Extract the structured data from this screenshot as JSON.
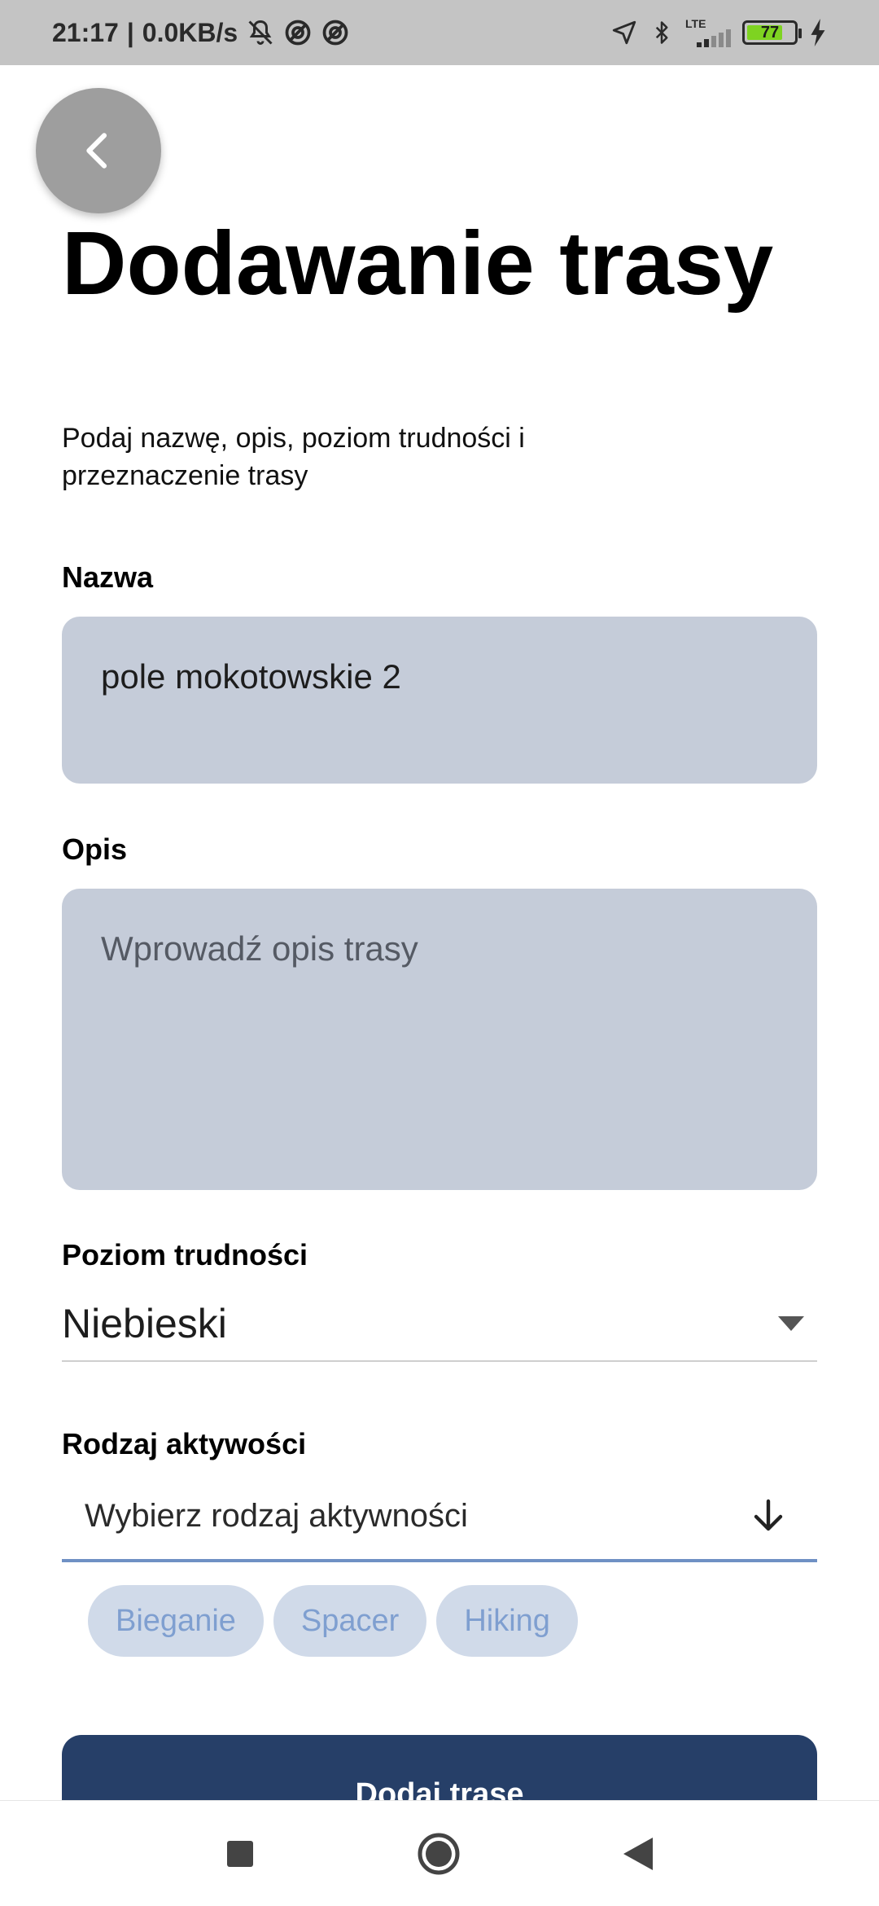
{
  "status_bar": {
    "time": "21:17",
    "speed": "0.0KB/s",
    "network": "LTE",
    "battery": "77",
    "battery_fraction": 0.77,
    "icons": [
      "mute-icon",
      "no-disturb-icon",
      "no-disturb-icon",
      "location-icon",
      "bluetooth-icon",
      "signal-icon",
      "battery-icon",
      "charging-icon"
    ]
  },
  "header": {
    "back_icon": "chevron-left-icon",
    "title": "Dodawanie trasy",
    "subtitle": "Podaj nazwę, opis, poziom trudności i przeznaczenie trasy"
  },
  "form": {
    "name_label": "Nazwa",
    "name_value": "pole mokotowskie 2",
    "description_label": "Opis",
    "description_placeholder": "Wprowadź opis trasy",
    "difficulty_label": "Poziom trudności",
    "difficulty_value": "Niebieski",
    "activity_label": "Rodzaj aktywości",
    "activity_placeholder": "Wybierz rodzaj aktywności",
    "activity_options": [
      "Bieganie",
      "Spacer",
      "Hiking"
    ],
    "submit_label": "Dodaj trasę"
  },
  "nav": {
    "icons": [
      "recents-square-icon",
      "home-circle-icon",
      "back-triangle-icon"
    ]
  },
  "colors": {
    "input_bg": "#c5ccd9",
    "chip_bg": "#d0dae9",
    "chip_text": "#7f9fd0",
    "primary": "#263f68",
    "battery_green": "#7ed321"
  }
}
